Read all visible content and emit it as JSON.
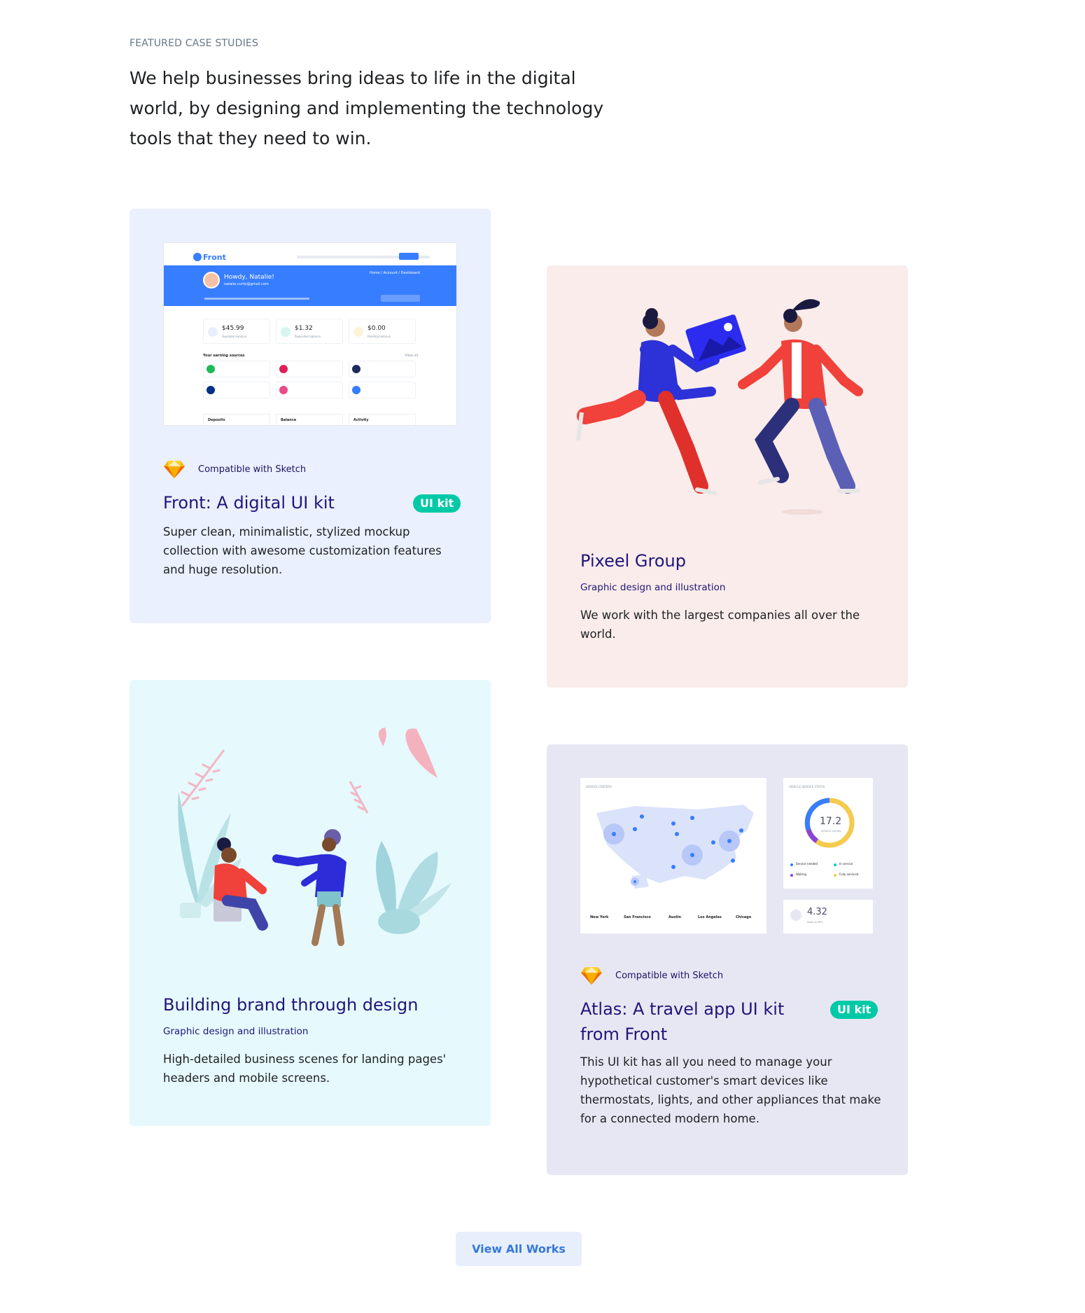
{
  "section": {
    "eyebrow": "FEATURED CASE STUDIES",
    "headline": "We help businesses bring ideas to life in the digital world, by designing and implementing the technology tools that they need to win."
  },
  "cards": {
    "front": {
      "compat": "Compatible with Sketch",
      "title": "Front: A digital UI kit",
      "badge": "UI kit",
      "description": "Super clean, minimalistic, stylized mockup collection with awesome customization features and huge resolution.",
      "mockup": {
        "brand": "Front",
        "greeting": "Howdy, Natalie!",
        "email": "natalie.curtis@gmail.com",
        "crumb": "Home  /  Account  /  Dashboard",
        "stats": [
          {
            "value": "$45.99",
            "label": "Available balance"
          },
          {
            "value": "$1.32",
            "label": "Rewarded balance"
          },
          {
            "value": "$0.00",
            "label": "Pending balance"
          }
        ],
        "earning_title": "Your earning sources",
        "view_all": "View all",
        "bottom_tabs": [
          "Deposits",
          "Balance",
          "Activity"
        ]
      }
    },
    "pixeel": {
      "title": "Pixeel Group",
      "subtitle": "Graphic design and illustration",
      "description": "We work with the largest companies all over the world."
    },
    "brand": {
      "title": "Building brand through design",
      "subtitle": "Graphic design and illustration",
      "description": "High-detailed business scenes for landing pages' headers and mobile screens."
    },
    "atlas": {
      "compat": "Compatible with Sketch",
      "title": "Atlas: A travel app UI kit from Front",
      "badge": "UI kit",
      "description": "This UI kit has all you need to manage your hypothetical customer's smart devices like thermostats, lights, and other appliances that make for a connected modern home.",
      "mockup": {
        "map_title": "SERVICE CENTERS",
        "cities": [
          "New York",
          "San Francisco",
          "Austin",
          "Los Angeles",
          "Chicago"
        ],
        "status_title": "VEHICLE SERVICE STATUS",
        "gauge_value": "17.2",
        "gauge_label": "SERVICE HOURS",
        "legend": [
          "Service needed",
          "In service",
          "Waiting",
          "Fully serviced"
        ],
        "metric_value": "4.32",
        "metric_label": "Medium MPG"
      }
    }
  },
  "cta": {
    "label": "View All Works"
  },
  "colors": {
    "accent": "#21157a",
    "badge": "#00c9a7",
    "primary": "#377dff"
  }
}
